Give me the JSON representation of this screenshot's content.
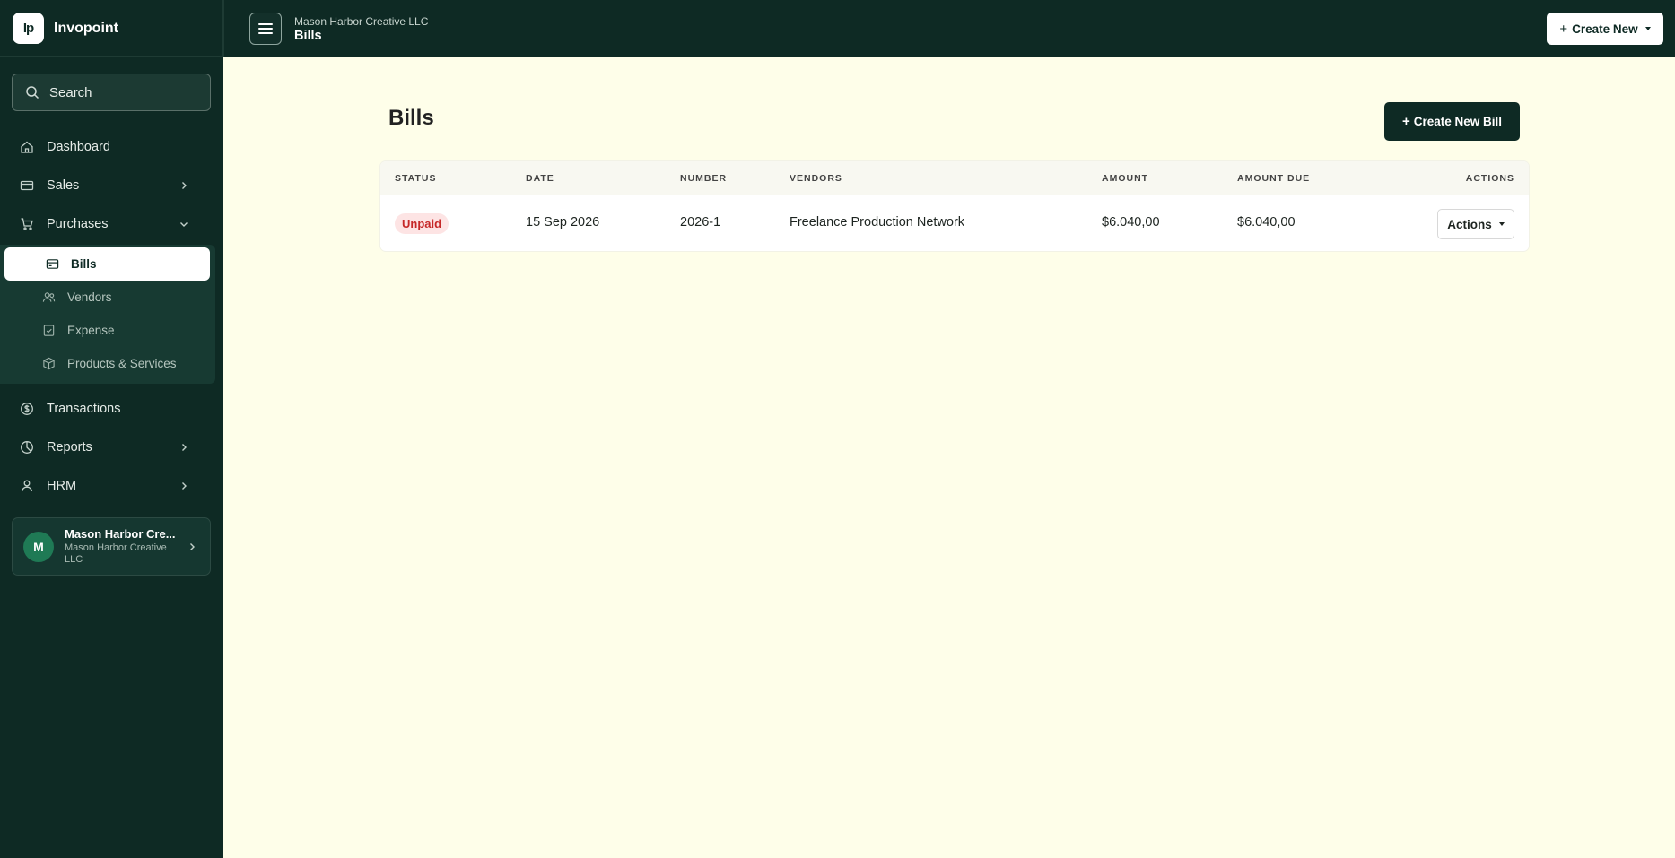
{
  "app": {
    "name": "Invopoint",
    "logo_text": "Ip"
  },
  "search": {
    "label": "Search"
  },
  "nav": {
    "dashboard": "Dashboard",
    "sales": "Sales",
    "purchases": "Purchases",
    "purchases_sub": {
      "bills": "Bills",
      "vendors": "Vendors",
      "expense": "Expense",
      "products_services": "Products & Services"
    },
    "transactions": "Transactions",
    "reports": "Reports",
    "hrm": "HRM"
  },
  "profile": {
    "initial": "M",
    "name": "Mason Harbor Cre...",
    "company": "Mason Harbor Creative LLC"
  },
  "header": {
    "company": "Mason Harbor Creative LLC",
    "title": "Bills",
    "create_new": "Create New"
  },
  "main": {
    "title": "Bills",
    "create_bill": "Create New Bill"
  },
  "table": {
    "columns": {
      "status": "STATUS",
      "date": "DATE",
      "number": "NUMBER",
      "vendors": "VENDORS",
      "amount": "AMOUNT",
      "amount_due": "AMOUNT DUE",
      "actions": "ACTIONS"
    },
    "rows": [
      {
        "status": "Unpaid",
        "date": "15 Sep 2026",
        "number": "2026-1",
        "vendor": "Freelance Production Network",
        "amount": "$6.040,00",
        "amount_due": "$6.040,00",
        "actions": "Actions"
      }
    ]
  },
  "colors": {
    "sidebar": "#0e2a24",
    "background": "#fefee9",
    "unpaid_badge_bg": "#fde4e4",
    "unpaid_badge_text": "#c62828"
  }
}
